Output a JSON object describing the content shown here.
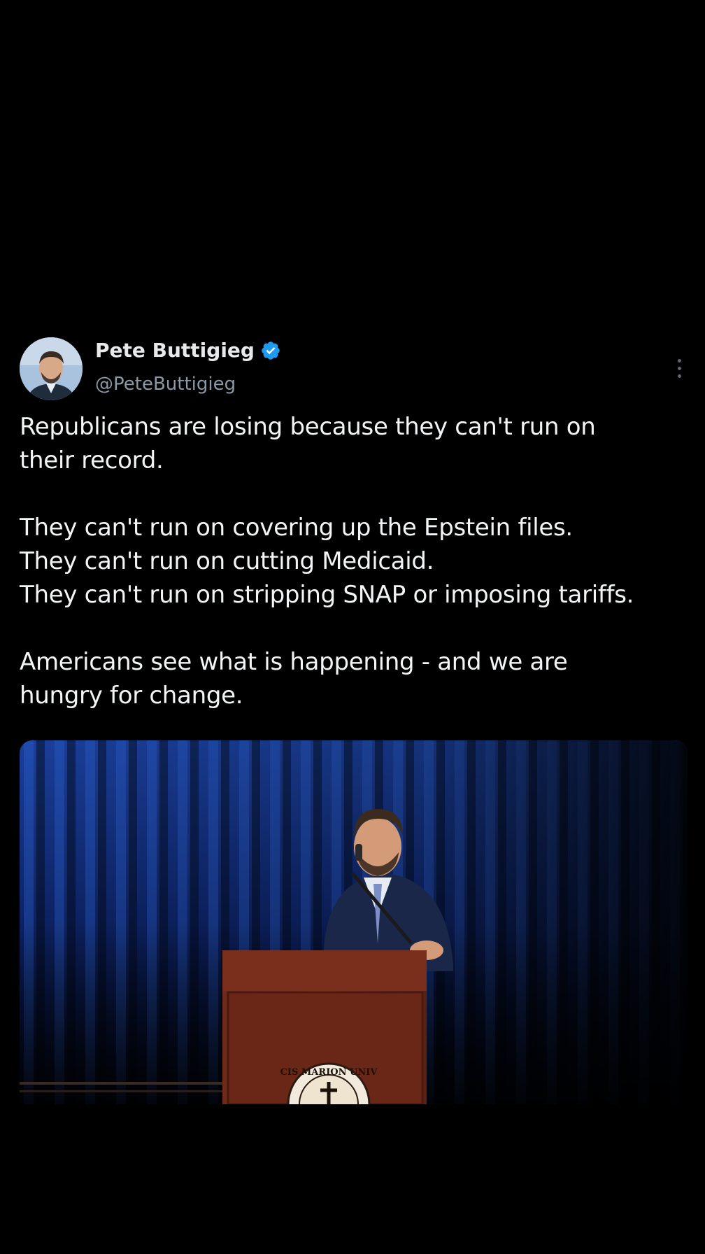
{
  "tweet": {
    "display_name": "Pete Buttigieg",
    "handle": "@PeteButtigieg",
    "verified": true,
    "accent_color": "#1d9bf0",
    "body_lines": [
      "Republicans are losing because they can't run on",
      "their record.",
      "",
      "They can't run on covering up the Epstein files.",
      "They can't run on cutting Medicaid.",
      "They can't run on stripping SNAP or imposing tariffs.",
      "",
      "Americans see what is happening - and we are",
      "hungry for change."
    ],
    "media": {
      "description_icon": "photo",
      "podium_seal_text": "CIS MARION UNIV"
    }
  },
  "icons": {
    "verified": "verified-badge-icon",
    "more": "more-vertical-icon"
  }
}
